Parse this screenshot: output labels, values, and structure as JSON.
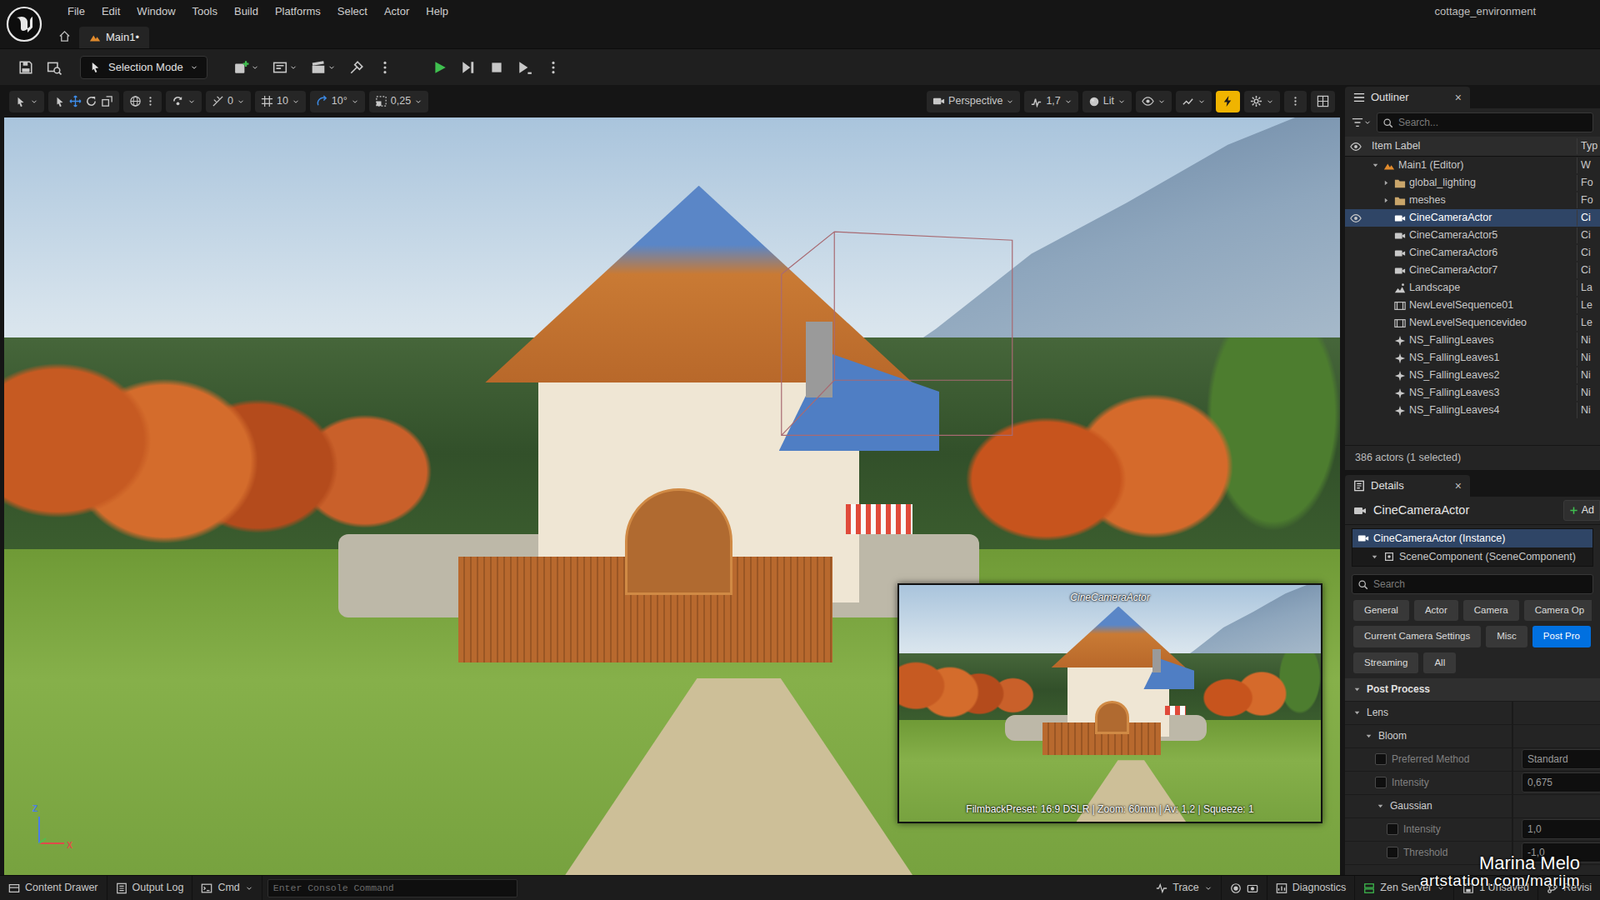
{
  "window": {
    "project": "cottage_environment"
  },
  "menu": [
    "File",
    "Edit",
    "Window",
    "Tools",
    "Build",
    "Platforms",
    "Select",
    "Actor",
    "Help"
  ],
  "tabs": [
    {
      "label": "Main1•",
      "selected": true
    }
  ],
  "toolbar": {
    "mode": "Selection Mode"
  },
  "viewport_toolbar": {
    "snaps": [
      {
        "label": "0",
        "active": false
      },
      {
        "label": "10",
        "active": false
      },
      {
        "label": "10°",
        "active": true
      },
      {
        "label": "0,25",
        "active": false
      }
    ],
    "view": "Perspective",
    "camera_speed": "1,7",
    "view_mode": "Lit",
    "performance_toggle_on": true
  },
  "viewport": {
    "axes": {
      "up": "Z",
      "right": "X"
    },
    "preview": {
      "title": "CineCameraActor",
      "info": "FilmbackPreset: 16:9 DSLR | Zoom: 60mm | Av: 1,2 | Squeeze: 1"
    }
  },
  "outliner": {
    "title": "Outliner",
    "close": "×",
    "search": {
      "placeholder": "Search..."
    },
    "columns": [
      "Item Label",
      "Typ"
    ],
    "rows": [
      {
        "label": "Main1 (Editor)",
        "type": "W",
        "kind": "level",
        "depth": 0,
        "expanded": true,
        "selected": false,
        "eye": false
      },
      {
        "label": "global_lighting",
        "type": "Fo",
        "kind": "folder",
        "depth": 1,
        "expanded": false,
        "selected": false,
        "eye": false
      },
      {
        "label": "meshes",
        "type": "Fo",
        "kind": "folder",
        "depth": 1,
        "expanded": false,
        "selected": false,
        "eye": false
      },
      {
        "label": "CineCameraActor",
        "type": "Ci",
        "kind": "camera",
        "depth": 1,
        "selected": true,
        "eye": true
      },
      {
        "label": "CineCameraActor5",
        "type": "Ci",
        "kind": "camera",
        "depth": 1,
        "selected": false,
        "eye": false
      },
      {
        "label": "CineCameraActor6",
        "type": "Ci",
        "kind": "camera",
        "depth": 1,
        "selected": false,
        "eye": false
      },
      {
        "label": "CineCameraActor7",
        "type": "Ci",
        "kind": "camera",
        "depth": 1,
        "selected": false,
        "eye": false
      },
      {
        "label": "Landscape",
        "type": "La",
        "kind": "landscape",
        "depth": 1,
        "selected": false,
        "eye": false
      },
      {
        "label": "NewLevelSequence01",
        "type": "Le",
        "kind": "sequence",
        "depth": 1,
        "selected": false,
        "eye": false
      },
      {
        "label": "NewLevelSequencevideo",
        "type": "Le",
        "kind": "sequence",
        "depth": 1,
        "selected": false,
        "eye": false
      },
      {
        "label": "NS_FallingLeaves",
        "type": "Ni",
        "kind": "niagara",
        "depth": 1,
        "selected": false,
        "eye": false
      },
      {
        "label": "NS_FallingLeaves1",
        "type": "Ni",
        "kind": "niagara",
        "depth": 1,
        "selected": false,
        "eye": false
      },
      {
        "label": "NS_FallingLeaves2",
        "type": "Ni",
        "kind": "niagara",
        "depth": 1,
        "selected": false,
        "eye": false
      },
      {
        "label": "NS_FallingLeaves3",
        "type": "Ni",
        "kind": "niagara",
        "depth": 1,
        "selected": false,
        "eye": false
      },
      {
        "label": "NS_FallingLeaves4",
        "type": "Ni",
        "kind": "niagara",
        "depth": 1,
        "selected": false,
        "eye": false
      }
    ],
    "footer": "386 actors (1 selected)"
  },
  "details": {
    "title": "Details",
    "close": "×",
    "actor": "CineCameraActor",
    "add": "Ad",
    "components": [
      {
        "label": "CineCameraActor (Instance)",
        "selected": true,
        "depth": 0
      },
      {
        "label": "SceneComponent (SceneComponent)",
        "selected": false,
        "depth": 1,
        "expanded": true
      }
    ],
    "search": {
      "placeholder": "Search"
    },
    "filters": [
      [
        {
          "label": "General",
          "selected": false
        },
        {
          "label": "Actor",
          "selected": false
        },
        {
          "label": "Camera",
          "selected": false
        },
        {
          "label": "Camera Op",
          "selected": false
        }
      ],
      [
        {
          "label": "Current Camera Settings",
          "selected": false
        },
        {
          "label": "Misc",
          "selected": false
        },
        {
          "label": "Post Pro",
          "selected": true
        }
      ],
      [
        {
          "label": "Streaming",
          "selected": false
        },
        {
          "label": "All",
          "selected": false
        }
      ]
    ],
    "properties": [
      {
        "kind": "category",
        "label": "Post Process",
        "depth": 0,
        "expanded": true
      },
      {
        "kind": "group",
        "label": "Lens",
        "depth": 0,
        "expanded": true
      },
      {
        "kind": "group",
        "label": "Bloom",
        "depth": 1,
        "expanded": true
      },
      {
        "kind": "property",
        "label": "Preferred Method",
        "value": "Standard",
        "depth": 2,
        "checked": false,
        "disabled": true
      },
      {
        "kind": "property",
        "label": "Intensity",
        "value": "0,675",
        "depth": 2,
        "checked": false,
        "disabled": true
      },
      {
        "kind": "group",
        "label": "Gaussian",
        "depth": 2,
        "expanded": true
      },
      {
        "kind": "property",
        "label": "Intensity",
        "value": "1,0",
        "depth": 3,
        "checked": false,
        "disabled": true
      },
      {
        "kind": "property",
        "label": "Threshold",
        "value": "-1,0",
        "depth": 3,
        "checked": false,
        "disabled": true
      }
    ]
  },
  "status_bar": {
    "items": [
      {
        "label": "Content Drawer",
        "dropdown": false
      },
      {
        "label": "Output Log",
        "dropdown": false
      },
      {
        "label": "Cmd",
        "dropdown": true
      }
    ],
    "console": {
      "placeholder": "Enter Console Command"
    },
    "right": [
      {
        "label": "Trace",
        "dropdown": true
      },
      {
        "label": "Diagnostics",
        "dropdown": false
      },
      {
        "label": "Zen Server",
        "dropdown": true
      },
      {
        "label": "1 Unsaved",
        "dropdown": false
      },
      {
        "label": "Revisi",
        "dropdown": false
      }
    ]
  },
  "watermark": {
    "name": "Marina Melo",
    "site": "artstation.com/marijm"
  }
}
